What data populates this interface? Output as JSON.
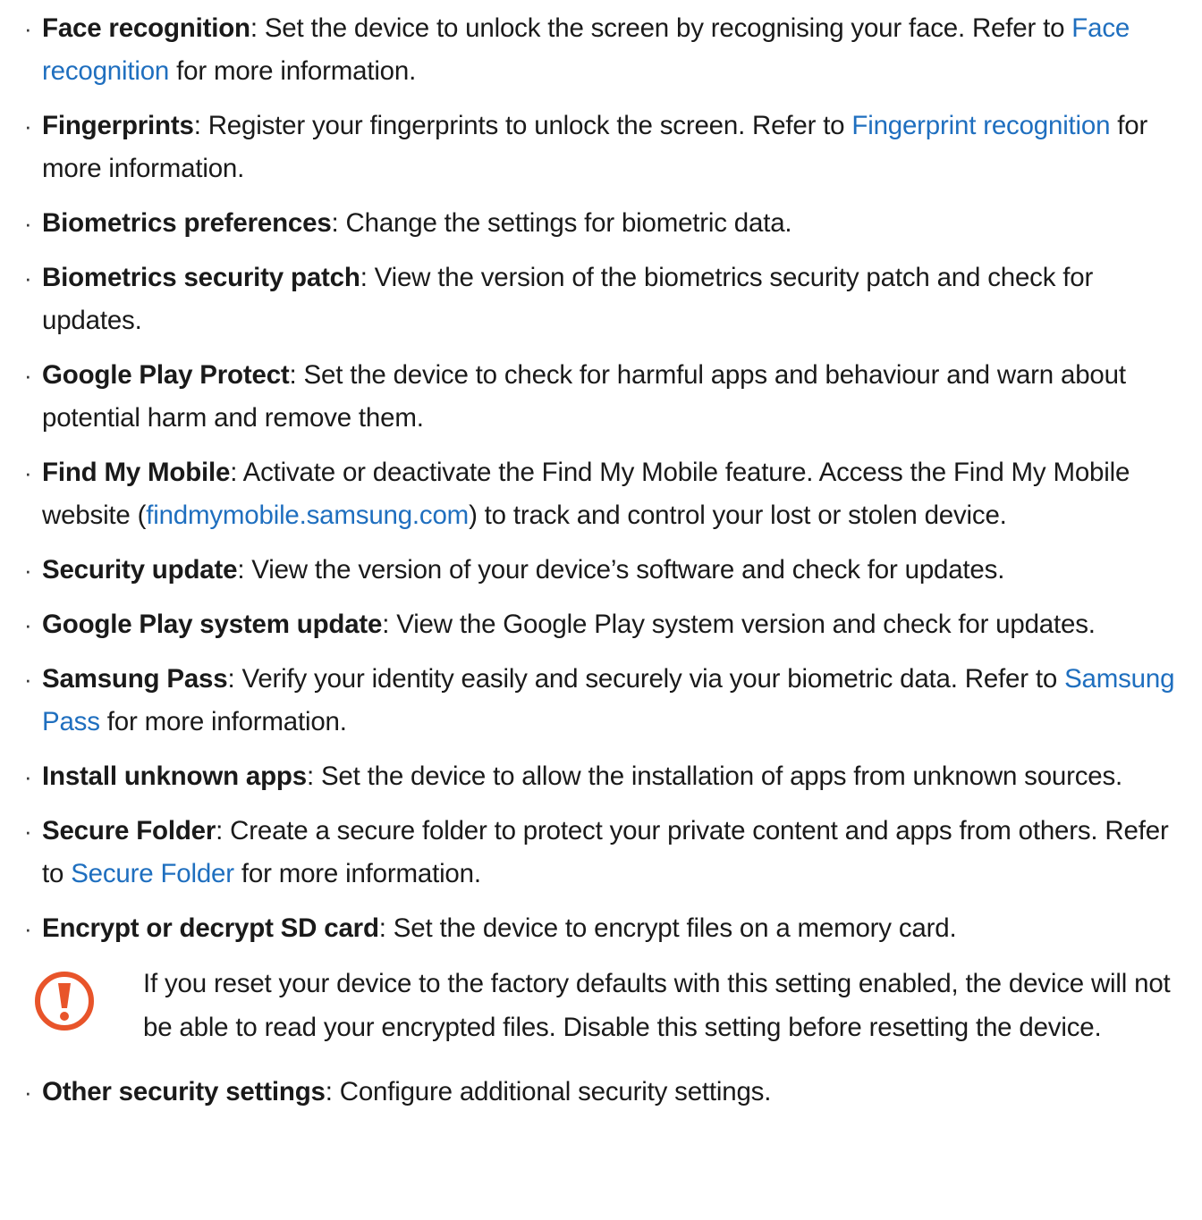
{
  "items": [
    {
      "term": "Face recognition",
      "text_before_link": ": Set the device to unlock the screen by recognising your face. Refer to ",
      "link": "Face recognition",
      "text_after_link": " for more information."
    },
    {
      "term": "Fingerprints",
      "text_before_link": ": Register your fingerprints to unlock the screen. Refer to ",
      "link": "Fingerprint recognition",
      "text_after_link": " for more information."
    },
    {
      "term": "Biometrics preferences",
      "text": ": Change the settings for biometric data."
    },
    {
      "term": "Biometrics security patch",
      "text": ": View the version of the biometrics security patch and check for updates."
    },
    {
      "term": "Google Play Protect",
      "text": ": Set the device to check for harmful apps and behaviour and warn about potential harm and remove them."
    },
    {
      "term": "Find My Mobile",
      "text_before_link": ": Activate or deactivate the Find My Mobile feature. Access the Find My Mobile website (",
      "link": "findmymobile.samsung.com",
      "text_after_link": ") to track and control your lost or stolen device."
    },
    {
      "term": "Security update",
      "text": ": View the version of your device’s software and check for updates."
    },
    {
      "term": "Google Play system update",
      "text": ": View the Google Play system version and check for updates."
    },
    {
      "term": "Samsung Pass",
      "text_before_link": ": Verify your identity easily and securely via your biometric data. Refer to ",
      "link": "Samsung Pass",
      "text_after_link": " for more information."
    },
    {
      "term": "Install unknown apps",
      "text": ": Set the device to allow the installation of apps from unknown sources."
    },
    {
      "term": "Secure Folder",
      "text_before_link": ": Create a secure folder to protect your private content and apps from others. Refer to ",
      "link": "Secure Folder",
      "text_after_link": " for more information."
    },
    {
      "term": "Encrypt or decrypt SD card",
      "text": ": Set the device to encrypt files on a memory card."
    },
    {
      "term": "Other security settings",
      "text": ": Configure additional security settings."
    }
  ],
  "warning": {
    "icon": "exclamation-warning-icon",
    "text": "If you reset your device to the factory defaults with this setting enabled, the device will not be able to read your encrypted files. Disable this setting before resetting the device."
  },
  "bullet_glyph": "·",
  "colors": {
    "link": "#1f6fbf",
    "warning_icon": "#e8542a",
    "text": "#1a1a1a"
  }
}
